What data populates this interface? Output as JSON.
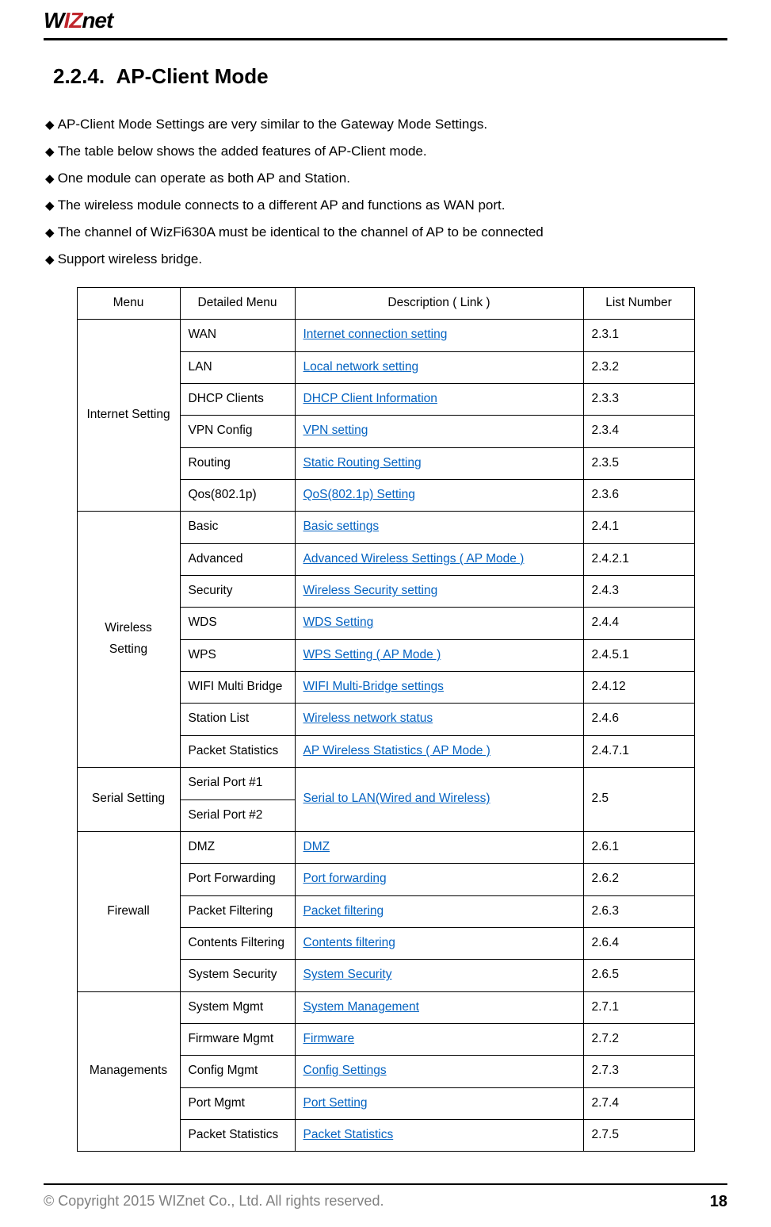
{
  "logo": {
    "part_w": "W",
    "part_iz": "IZ",
    "part_net": "net"
  },
  "section_number": "2.2.4.",
  "section_title": "AP-Client Mode",
  "bullets": [
    "AP-Client Mode Settings are very similar to the Gateway Mode Settings.",
    "The table below shows the added features of AP-Client mode.",
    "One module can operate as both AP and Station.",
    "The wireless module connects to a different AP and functions as WAN port.",
    "The channel of WizFi630A must be identical to the channel of AP to be connected",
    "Support wireless bridge."
  ],
  "table": {
    "headers": {
      "menu": "Menu",
      "detail": "Detailed Menu",
      "desc": "Description ( Link )",
      "list": "List Number"
    },
    "groups": [
      {
        "menu": "Internet Setting",
        "rows": [
          {
            "detail": "WAN",
            "desc": "Internet connection setting",
            "list": "2.3.1"
          },
          {
            "detail": "LAN",
            "desc": "Local network setting",
            "list": "2.3.2"
          },
          {
            "detail": "DHCP Clients",
            "desc": "DHCP Client Information",
            "list": "2.3.3"
          },
          {
            "detail": "VPN Config",
            "desc": "VPN setting",
            "list": "2.3.4"
          },
          {
            "detail": "Routing",
            "desc": "Static Routing Setting",
            "list": "2.3.5"
          },
          {
            "detail": "Qos(802.1p)",
            "desc": "QoS(802.1p) Setting",
            "list": "2.3.6"
          }
        ]
      },
      {
        "menu": "Wireless Setting",
        "rows": [
          {
            "detail": "Basic",
            "desc": "Basic settings",
            "list": "2.4.1"
          },
          {
            "detail": "Advanced",
            "desc": "Advanced Wireless Settings ( AP Mode )",
            "list": "2.4.2.1"
          },
          {
            "detail": "Security",
            "desc": "Wireless Security setting",
            "list": "2.4.3"
          },
          {
            "detail": "WDS",
            "desc": "WDS Setting",
            "list": "2.4.4"
          },
          {
            "detail": "WPS",
            "desc": "WPS Setting ( AP Mode )",
            "list": "2.4.5.1"
          },
          {
            "detail": "WIFI Multi Bridge",
            "desc": "WIFI Multi-Bridge settings",
            "list": "2.4.12"
          },
          {
            "detail": "Station List",
            "desc": "Wireless network status",
            "list": "2.4.6"
          },
          {
            "detail": "Packet Statistics",
            "desc": "AP Wireless Statistics ( AP Mode )",
            "list": "2.4.7.1"
          }
        ]
      },
      {
        "menu": "Serial Setting",
        "serial": {
          "detail1": "Serial Port #1",
          "detail2": "Serial Port #2",
          "desc": "Serial to LAN(Wired and Wireless)",
          "list": "2.5"
        }
      },
      {
        "menu": "Firewall",
        "rows": [
          {
            "detail": "DMZ",
            "desc": "DMZ",
            "list": "2.6.1"
          },
          {
            "detail": "Port Forwarding",
            "desc": "Port forwarding",
            "list": "2.6.2"
          },
          {
            "detail": "Packet Filtering",
            "desc": "Packet filtering",
            "list": "2.6.3"
          },
          {
            "detail": "Contents Filtering",
            "desc": "Contents filtering",
            "list": "2.6.4"
          },
          {
            "detail": "System Security",
            "desc": "System Security",
            "list": "2.6.5"
          }
        ]
      },
      {
        "menu": "Managements",
        "rows": [
          {
            "detail": "System Mgmt",
            "desc": "System Management",
            "list": "2.7.1"
          },
          {
            "detail": "Firmware Mgmt",
            "desc": "Firmware",
            "list": "2.7.2"
          },
          {
            "detail": "Config Mgmt",
            "desc": "Config Settings",
            "list": "2.7.3"
          },
          {
            "detail": "Port Mgmt",
            "desc": "Port Setting",
            "list": "2.7.4"
          },
          {
            "detail": "Packet Statistics",
            "desc": "Packet Statistics",
            "list": "2.7.5"
          }
        ]
      }
    ]
  },
  "footer": {
    "copyright": "© Copyright 2015 WIZnet Co., Ltd. All rights reserved.",
    "page": "18"
  }
}
